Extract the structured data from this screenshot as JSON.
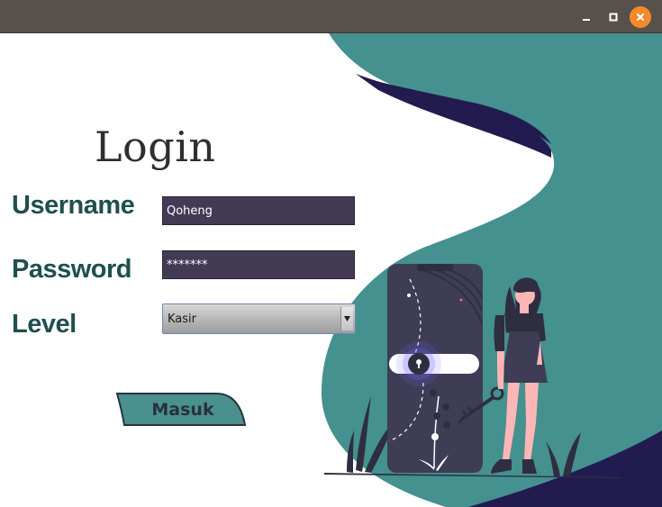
{
  "window": {
    "controls": [
      "minimize-icon",
      "maximize-icon",
      "close-icon"
    ],
    "titlebar_color": "#58504a",
    "close_color": "#f28a2b"
  },
  "form": {
    "title": "Login",
    "username_label": "Username",
    "username_value": "Qoheng",
    "password_label": "Password",
    "password_value": "*******",
    "level_label": "Level",
    "level_selected": "Kasir",
    "submit_label": "Masuk"
  },
  "theme": {
    "teal": "#44918f",
    "navy": "#221b4f",
    "label_color": "#1f4f4f",
    "field_bg": "#433b55"
  }
}
